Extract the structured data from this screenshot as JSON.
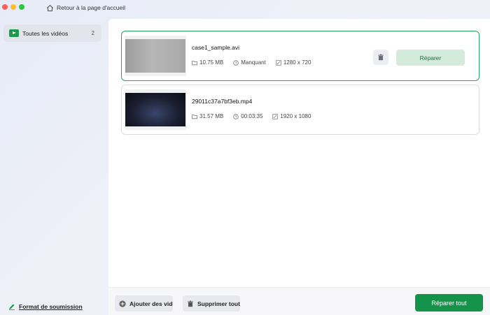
{
  "titlebar": {
    "back_label": "Retour à la page d'accueil"
  },
  "sidebar": {
    "items": [
      {
        "label": "Toutes les vidéos",
        "count": "2"
      }
    ],
    "format_link": "Format de soumission"
  },
  "videos": [
    {
      "name": "case1_sample.avi",
      "size": "10.75 MB",
      "duration": "Manquant",
      "resolution": "1280 x 720",
      "selected": true,
      "repair_label": "Réparer"
    },
    {
      "name": "29011c37a7bf3eb.mp4",
      "size": "31.57 MB",
      "duration": "00:03:35",
      "resolution": "1920 x 1080",
      "selected": false
    }
  ],
  "footer": {
    "add_label": "Ajouter des vidéos",
    "delete_all_label": "Supprimer tout",
    "repair_all_label": "Réparer tout"
  },
  "colors": {
    "accent": "#16934a",
    "repair_button_bg": "#d4ebdb",
    "selected_border": "#27a35a"
  }
}
